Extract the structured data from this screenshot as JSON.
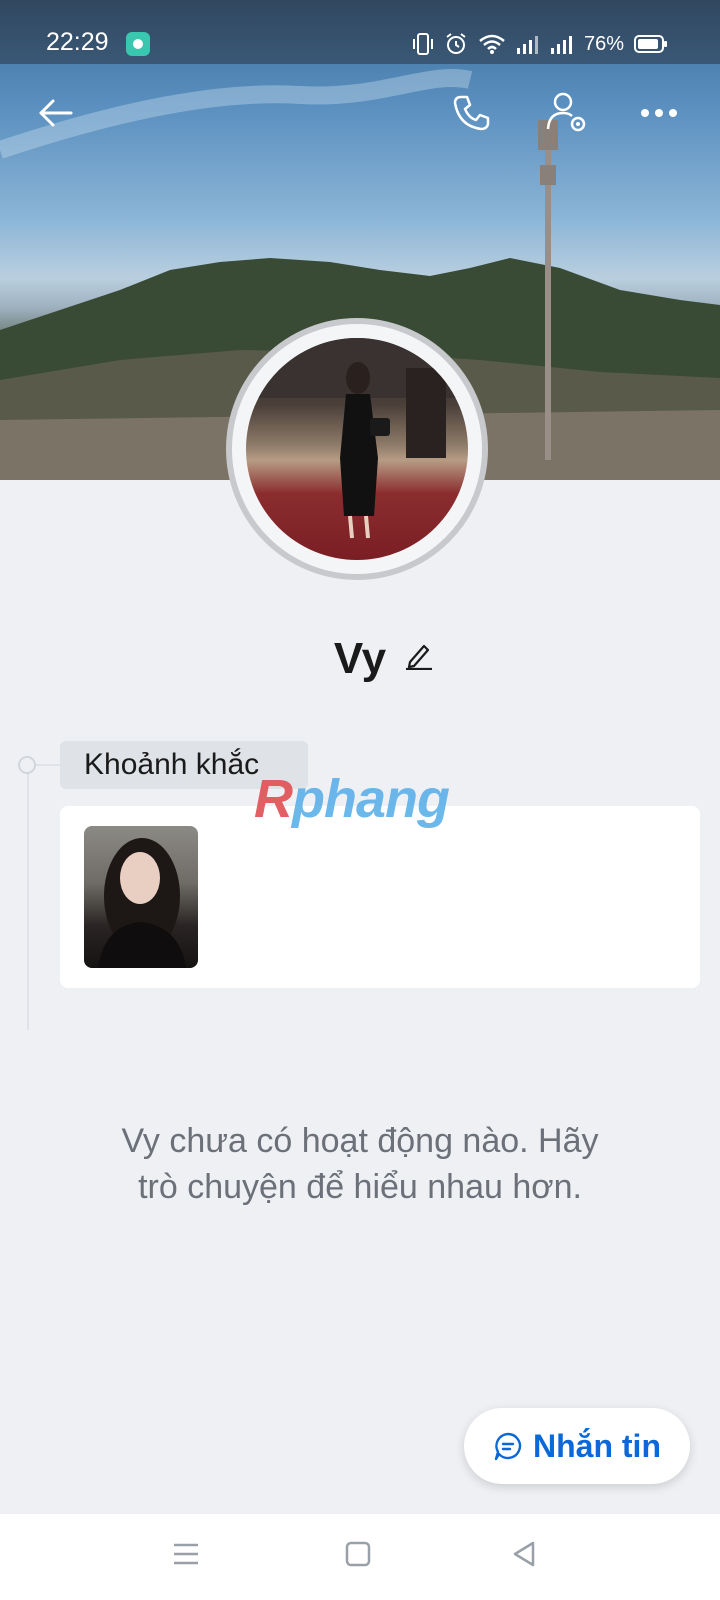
{
  "status_bar": {
    "time": "22:29",
    "battery_percent": "76%",
    "icons": [
      "vibrate-icon",
      "alarm-icon",
      "wifi-icon",
      "signal-icon",
      "signal-icon",
      "battery-icon"
    ]
  },
  "header": {
    "back_icon": "arrow-left-icon",
    "call_icon": "phone-icon",
    "settings_icon": "user-settings-icon",
    "more_icon": "more-horizontal-icon"
  },
  "profile": {
    "name": "Vy"
  },
  "moments": {
    "label": "Khoảnh khắc"
  },
  "watermark": {
    "r": "R",
    "rest": "phang"
  },
  "empty_state": {
    "line1": "Vy chưa có hoạt động nào. Hãy",
    "line2": "trò chuyện để hiểu nhau hơn."
  },
  "message_button": {
    "label": "Nhắn tin"
  },
  "colors": {
    "accent": "#0a68d9",
    "background": "#eef0f4"
  }
}
